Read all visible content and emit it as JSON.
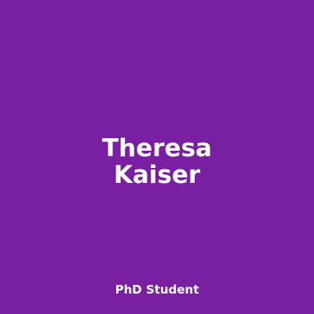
{
  "card": {
    "first_name": "Theresa",
    "last_name": "Kaiser",
    "role": "PhD Student",
    "background": "#7b1fa2"
  }
}
